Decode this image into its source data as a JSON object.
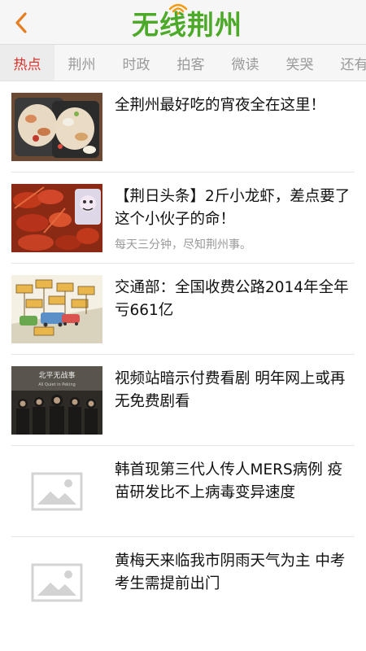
{
  "header": {
    "back_icon": "chevron-left-icon",
    "logo_text": "无线荆州",
    "logo_icon": "wifi-icon",
    "colors": {
      "logo": "#4caa28",
      "accent": "#d9322a",
      "back": "#e67e22"
    }
  },
  "tabs": [
    {
      "label": "热点",
      "active": true
    },
    {
      "label": "荆州",
      "active": false
    },
    {
      "label": "时政",
      "active": false
    },
    {
      "label": "拍客",
      "active": false
    },
    {
      "label": "微读",
      "active": false
    },
    {
      "label": "笑哭",
      "active": false
    },
    {
      "label": "还有",
      "active": false
    }
  ],
  "news": [
    {
      "title": "全荆州最好吃的宵夜全在这里！",
      "subtitle": "",
      "thumb": "food-photo"
    },
    {
      "title": "【荆日头条】2斤小龙虾，差点要了这个小伙子的命！",
      "subtitle": "每天三分钟，尽知荆州事。",
      "thumb": "crayfish-photo"
    },
    {
      "title": "交通部：全国收费公路2014年全年亏661亿",
      "subtitle": "",
      "thumb": "toll-cartoon"
    },
    {
      "title": "视频站暗示付费看剧 明年网上或再无免费剧看",
      "subtitle": "",
      "thumb": "drama-poster"
    },
    {
      "title": "韩首现第三代人传人MERS病例 疫苗研发比不上病毒变异速度",
      "subtitle": "",
      "thumb": "image-placeholder-icon"
    },
    {
      "title": "黄梅天来临我市阴雨天气为主 中考考生需提前出门",
      "subtitle": "",
      "thumb": "image-placeholder-icon"
    }
  ],
  "thumb_texts": {
    "toll_sign": "收费站",
    "poster_title": "北平无战事",
    "poster_subtitle": "All Quiet in Peking"
  }
}
